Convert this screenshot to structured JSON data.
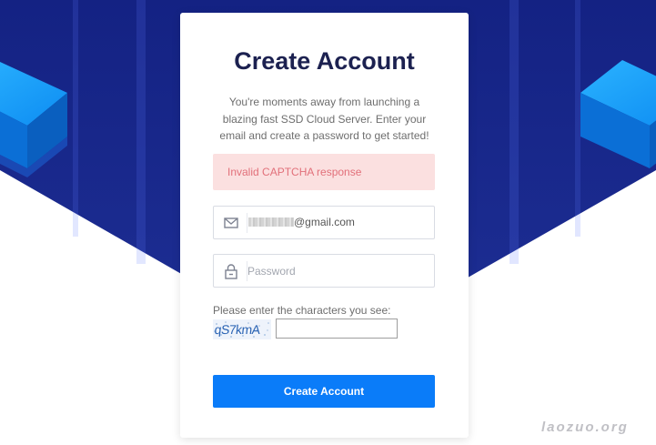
{
  "colors": {
    "background_navy": "#1b2b8a",
    "title_color": "#1c2150",
    "alert_bg": "#fbe0e0",
    "alert_text": "#e2707a",
    "button_blue": "#0a7cf9",
    "cube_blue": "#1296f5"
  },
  "form": {
    "title": "Create Account",
    "subtitle": "You're moments away from launching a blazing fast SSD Cloud Server. Enter your email and create a password to get started!",
    "error_message": "Invalid CAPTCHA response",
    "email_icon": "envelope-icon",
    "email_value_suffix": "@gmail.com",
    "password_icon": "lock-icon",
    "password_placeholder": "Password",
    "captcha_label": "Please enter the characters you see:",
    "captcha_text": "qS7kmA",
    "captcha_value": "",
    "submit_label": "Create Account"
  },
  "watermark": "laozuo.org"
}
